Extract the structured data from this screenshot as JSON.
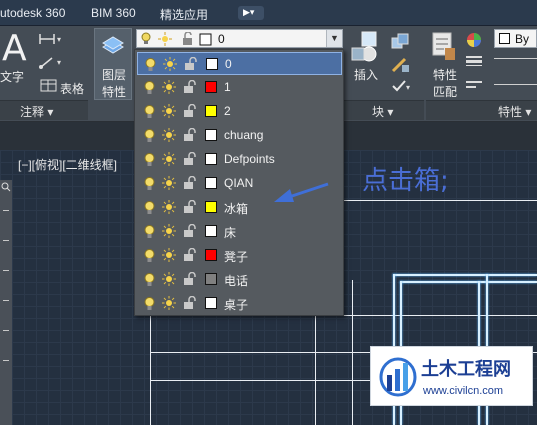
{
  "menu": {
    "items": [
      "utodesk 360",
      "BIM 360",
      "精选应用"
    ],
    "chip_icon": "video-camera-icon"
  },
  "ribbon": {
    "big_letter": "A",
    "text_label": "文字",
    "table_label": "表格",
    "layer_props_label_1": "图层",
    "layer_props_label_2": "特性",
    "insert_label": "插入",
    "match_label_1": "特性",
    "match_label_2": "匹配",
    "by_label": "By",
    "current_layer": "0",
    "panels": {
      "annotation": "注释 ▾",
      "block": "块 ▾",
      "properties": "特性 ▾"
    }
  },
  "viewport_label": "[−][俯视][二维线框]",
  "annotation_text": "点击箱;",
  "layers": [
    {
      "name": "0",
      "color": "#ffffff",
      "selected": true
    },
    {
      "name": "1",
      "color": "#ff0000",
      "selected": false
    },
    {
      "name": "2",
      "color": "#ffff00",
      "selected": false
    },
    {
      "name": "chuang",
      "color": "#ffffff",
      "selected": false
    },
    {
      "name": "Defpoints",
      "color": "#ffffff",
      "selected": false
    },
    {
      "name": "QIAN",
      "color": "#ffffff",
      "selected": false
    },
    {
      "name": "冰箱",
      "color": "#ffff00",
      "selected": false
    },
    {
      "name": "床",
      "color": "#ffffff",
      "selected": false
    },
    {
      "name": "凳子",
      "color": "#ff0000",
      "selected": false
    },
    {
      "name": "电话",
      "color": "#808080",
      "selected": false
    },
    {
      "name": "桌子",
      "color": "#ffffff",
      "selected": false
    }
  ],
  "watermark": {
    "title": "土木工程网",
    "url": "www.civilcn.com"
  },
  "colors": {
    "accent": "#4c6fa3",
    "annotation": "#4a6ed6",
    "arrow": "#3f6fd8"
  }
}
